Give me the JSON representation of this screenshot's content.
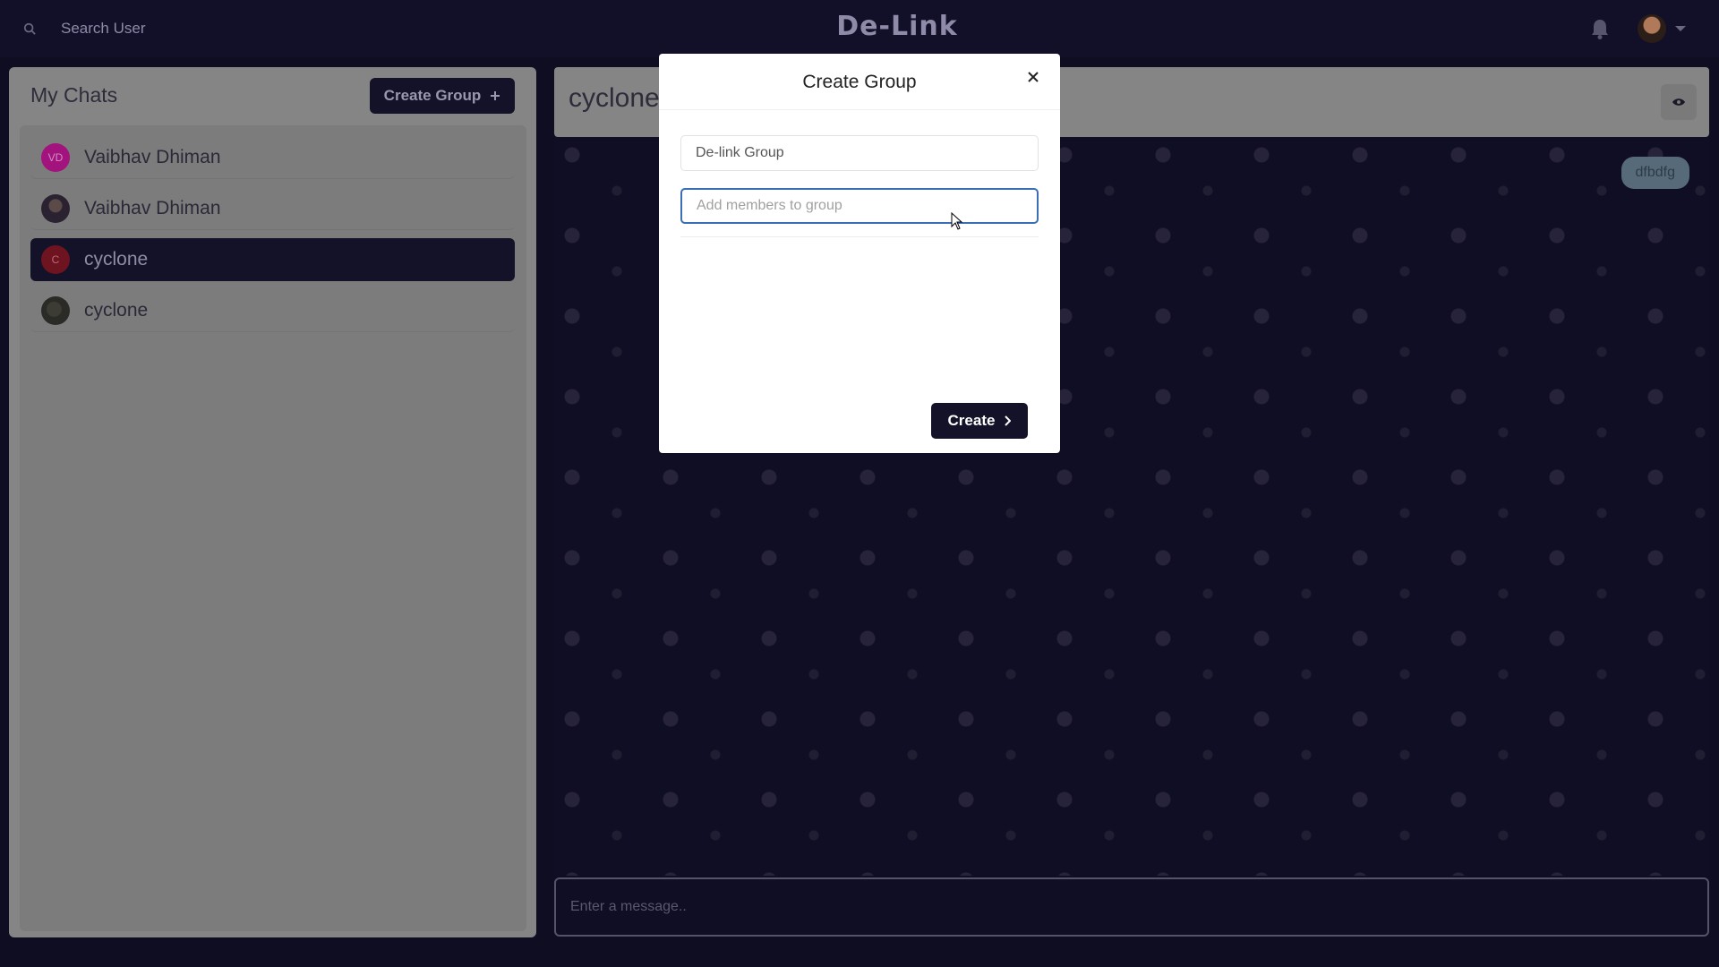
{
  "topbar": {
    "search_label": "Search User",
    "brand": "De-Link"
  },
  "sidebar": {
    "title": "My Chats",
    "create_group_label": "Create Group",
    "chats": [
      {
        "name": "Vaibhav Dhiman",
        "avatar_text": "VD",
        "avatar_color": "#a2137e"
      },
      {
        "name": "Vaibhav Dhiman",
        "avatar_text": ""
      },
      {
        "name": "cyclone",
        "avatar_text": "C",
        "avatar_color": "#6e1320"
      },
      {
        "name": "cyclone",
        "avatar_text": ""
      }
    ]
  },
  "chat": {
    "name": "cyclone",
    "messages": [
      {
        "text": "dfbdfg"
      }
    ],
    "input_placeholder": "Enter a message.."
  },
  "modal": {
    "title": "Create Group",
    "group_name_value": "De-link Group",
    "members_placeholder": "Add members to group",
    "create_label": "Create"
  },
  "colors": {
    "dark": "#141228",
    "focus_border": "#3b6eb4"
  }
}
